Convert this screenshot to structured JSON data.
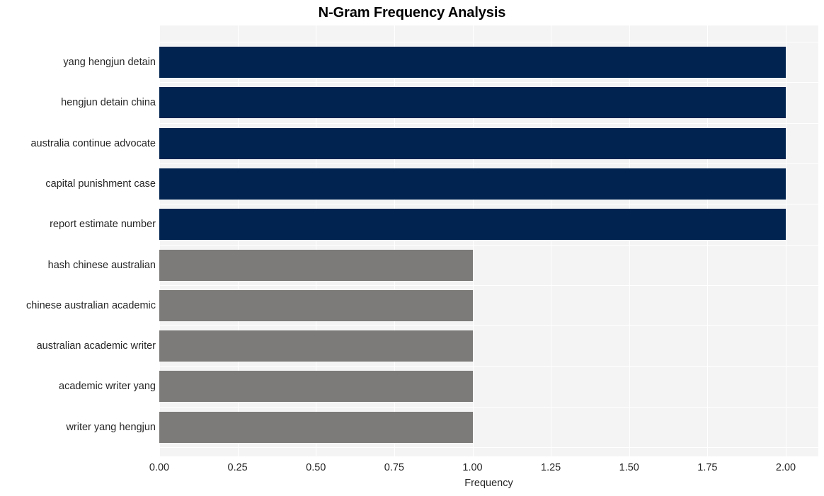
{
  "chart_data": {
    "type": "bar",
    "orientation": "horizontal",
    "title": "N-Gram Frequency Analysis",
    "xlabel": "Frequency",
    "ylabel": "",
    "xlim": [
      0,
      2
    ],
    "grid": true,
    "legend": "none",
    "xticks": [
      "0.00",
      "0.25",
      "0.50",
      "0.75",
      "1.00",
      "1.25",
      "1.50",
      "1.75",
      "2.00"
    ],
    "xtick_values": [
      0,
      0.25,
      0.5,
      0.75,
      1.0,
      1.25,
      1.5,
      1.75,
      2.0
    ],
    "categories": [
      "yang hengjun detain",
      "hengjun detain china",
      "australia continue advocate",
      "capital punishment case",
      "report estimate number",
      "hash chinese australian",
      "chinese australian academic",
      "australian academic writer",
      "academic writer yang",
      "writer yang hengjun"
    ],
    "values": [
      2,
      2,
      2,
      2,
      2,
      1,
      1,
      1,
      1,
      1
    ],
    "bar_colors": [
      "#00234f",
      "#00234f",
      "#00234f",
      "#00234f",
      "#00234f",
      "#7c7b79",
      "#7c7b79",
      "#7c7b79",
      "#7c7b79",
      "#7c7b79"
    ],
    "colors": {
      "accent_primary": "#00234f",
      "accent_secondary": "#7c7b79",
      "plot_background": "#f4f4f5",
      "gridline": "#ffffff",
      "text": "#262626",
      "title": "#000000",
      "figure_background": "#ffffff"
    }
  }
}
